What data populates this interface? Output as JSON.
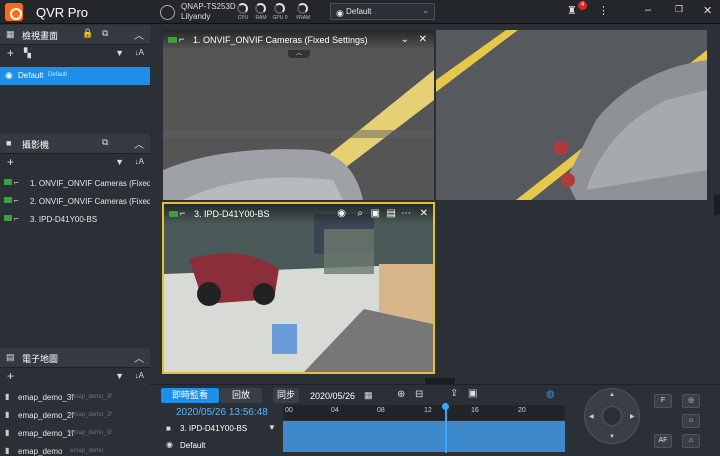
{
  "app": {
    "title": "QVR Pro",
    "logo_color": "#ff6a1a",
    "accent": "#1e8ee8"
  },
  "topbar": {
    "nas_name": "QNAP-TS253D",
    "user": "Lilyandy",
    "gauges": [
      "CPU",
      "RAM",
      "GPU 0",
      "VRAM"
    ],
    "view_select": "Default",
    "alert_count": "4",
    "icons": [
      "alert-bell-icon",
      "more-vert-icon",
      "minimize-icon",
      "restore-icon",
      "close-icon"
    ]
  },
  "layouts": {
    "title": "檢視畫面",
    "items": [
      {
        "label": "Default",
        "sub": "Default"
      }
    ]
  },
  "cameras": {
    "title": "攝影機",
    "items": [
      {
        "label": "1. ONVIF_ONVIF Cameras (Fixed ..."
      },
      {
        "label": "2. ONVIF_ONVIF Cameras (Fixed ..."
      },
      {
        "label": "3. IPD-D41Y00-BS"
      }
    ]
  },
  "emap": {
    "title": "電子地圖",
    "items": [
      {
        "label": "emap_demo_3f",
        "sub": "emap_demo_3f"
      },
      {
        "label": "emap_demo_2f",
        "sub": "emap_demo_2f"
      },
      {
        "label": "emap_demo_1f",
        "sub": "emap_demo_1f"
      },
      {
        "label": "emap_demo",
        "sub": "emap_demo"
      }
    ]
  },
  "tiles": [
    {
      "title": "1. ONVIF_ONVIF Cameras (Fixed Settings)"
    },
    {
      "title": ""
    },
    {
      "title": "3. IPD-D41Y00-BS"
    }
  ],
  "timeline": {
    "live_tab": "即時監看",
    "playback_tab": "回放",
    "sync": "同步",
    "date": "2020/05/26",
    "timestamp": "2020/05/26 13:56:48",
    "ticks": [
      "00",
      "04",
      "08",
      "12",
      "16",
      "20"
    ],
    "rows": [
      {
        "label": "3. IPD-D41Y00-BS"
      },
      {
        "label": "Default"
      }
    ]
  },
  "ptz": {
    "buttons": [
      "F",
      "AF"
    ]
  }
}
